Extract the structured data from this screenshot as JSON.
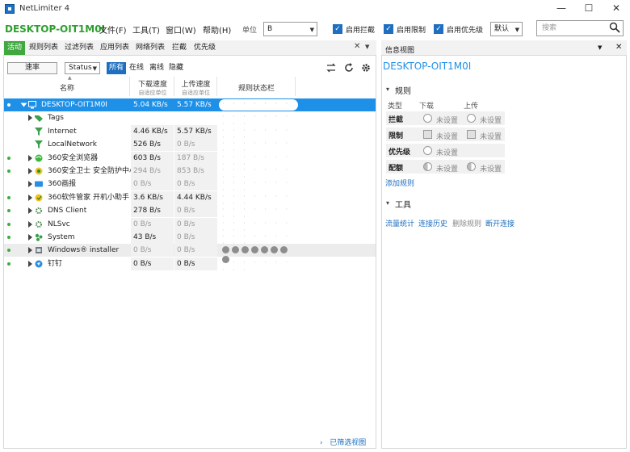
{
  "window": {
    "title": "NetLimiter 4",
    "minimize": "—",
    "maximize": "☐",
    "close": "✕"
  },
  "menubar": {
    "machine": "DESKTOP-OIT1M0I",
    "menus": [
      "文件(F)",
      "工具(T)",
      "窗口(W)",
      "帮助(H)"
    ],
    "unit_label": "单位",
    "unit_value": "B",
    "checkboxes": [
      "启用拦截",
      "启用限制",
      "启用优先级"
    ],
    "mode_value": "默认",
    "search_placeholder": "搜索"
  },
  "tabs": {
    "items": [
      "活动",
      "规则列表",
      "过滤列表",
      "应用列表",
      "网络列表",
      "拦截",
      "优先级"
    ],
    "active": 0,
    "close": "✕",
    "menu": "▼"
  },
  "toolbar": {
    "filter_button": "速率",
    "status_value": "Status",
    "segments": [
      "所有",
      "在线",
      "离线",
      "隐藏"
    ],
    "active_segment": 0
  },
  "grid": {
    "headers": {
      "name": "名称",
      "download": "下载速度",
      "download_sub": "自适应单位",
      "upload": "上传速度",
      "upload_sub": "自适应单位",
      "rules": "规则状态栏"
    },
    "rows": [
      {
        "name": "DESKTOP-OIT1M0I",
        "down": "5.04 KB/s",
        "up": "5.57 KB/s",
        "dot": true,
        "expander": "▾",
        "icon": "monitor-icon",
        "selected": true,
        "indent": 0,
        "down_faded": false,
        "up_faded": false
      },
      {
        "name": "Tags",
        "down": "",
        "up": "",
        "dot": false,
        "expander": "▸",
        "icon": "tag-icon",
        "indent": 1,
        "down_faded": false,
        "up_faded": false
      },
      {
        "name": "Internet",
        "down": "4.46 KB/s",
        "up": "5.57 KB/s",
        "dot": false,
        "expander": "",
        "icon": "filter-icon",
        "indent": 1,
        "down_faded": false,
        "up_faded": false
      },
      {
        "name": "LocalNetwork",
        "down": "526 B/s",
        "up": "0 B/s",
        "dot": false,
        "expander": "",
        "icon": "filter-icon",
        "indent": 1,
        "down_faded": false,
        "up_faded": true
      },
      {
        "name": "360安全浏览器",
        "down": "603 B/s",
        "up": "187 B/s",
        "dot": true,
        "expander": "▸",
        "icon": "browser360-icon",
        "indent": 1,
        "down_faded": false,
        "up_faded": true
      },
      {
        "name": "360安全卫士 安全防护中心模块",
        "down": "294 B/s",
        "up": "853 B/s",
        "dot": true,
        "expander": "▸",
        "icon": "guard360-icon",
        "indent": 1,
        "down_faded": true,
        "up_faded": true
      },
      {
        "name": "360画报",
        "down": "0 B/s",
        "up": "0 B/s",
        "dot": false,
        "expander": "▸",
        "icon": "pictorial360-icon",
        "indent": 1,
        "down_faded": true,
        "up_faded": true
      },
      {
        "name": "360软件管家 开机小助手",
        "down": "3.6 KB/s",
        "up": "4.44 KB/s",
        "dot": true,
        "expander": "▸",
        "icon": "softmgr360-icon",
        "indent": 1,
        "down_faded": false,
        "up_faded": false
      },
      {
        "name": "DNS Client",
        "down": "278 B/s",
        "up": "0 B/s",
        "dot": true,
        "expander": "▸",
        "icon": "gear-icon",
        "indent": 1,
        "down_faded": false,
        "up_faded": true
      },
      {
        "name": "NLSvc",
        "down": "0 B/s",
        "up": "0 B/s",
        "dot": true,
        "expander": "▸",
        "icon": "gear-icon",
        "indent": 1,
        "down_faded": true,
        "up_faded": true
      },
      {
        "name": "System",
        "down": "43 B/s",
        "up": "0 B/s",
        "dot": true,
        "expander": "▸",
        "icon": "system-icon",
        "indent": 1,
        "down_faded": false,
        "up_faded": true
      },
      {
        "name": "Windows® installer",
        "down": "0 B/s",
        "up": "0 B/s",
        "dot": true,
        "expander": "▸",
        "icon": "installer-icon",
        "indent": 1,
        "hover": true,
        "down_faded": true,
        "up_faded": true
      },
      {
        "name": "钉钉",
        "down": "0 B/s",
        "up": "0 B/s",
        "dot": true,
        "expander": "▸",
        "icon": "dingtalk-icon",
        "indent": 1,
        "down_faded": false,
        "up_faded": false
      }
    ]
  },
  "footer": {
    "filtered_view": "已筛选视图",
    "arrow": "›"
  },
  "info": {
    "panel_title": "信息视图",
    "close": "✕",
    "menu": "▼",
    "machine": "DESKTOP-OIT1M0I",
    "rules_section": "规则",
    "col_type": "类型",
    "col_download": "下载",
    "col_upload": "上传",
    "rule_rows": [
      {
        "label": "拦截",
        "kind": "radio",
        "down": "未设置",
        "up": "未设置"
      },
      {
        "label": "限制",
        "kind": "box",
        "down": "未设置",
        "up": "未设置"
      },
      {
        "label": "优先级",
        "kind": "radio",
        "down": "未设置",
        "up": ""
      },
      {
        "label": "配额",
        "kind": "half",
        "down": "未设置",
        "up": "未设置"
      }
    ],
    "add_rule": "添加规则",
    "tools_section": "工具",
    "tools": [
      "流量统计",
      "连接历史",
      "删除规则",
      "断开连接"
    ],
    "tools_disabled": [
      false,
      false,
      true,
      false
    ]
  }
}
